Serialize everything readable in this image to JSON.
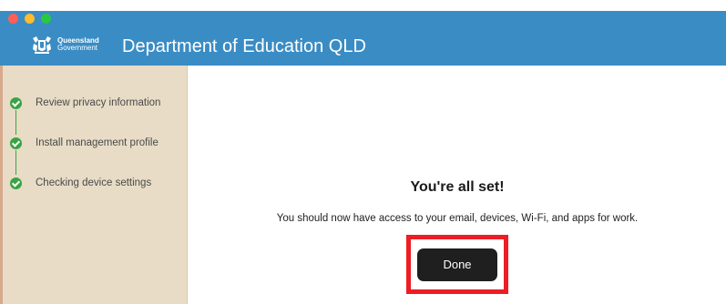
{
  "window": {
    "title": "Department of Education QLD"
  },
  "brand": {
    "line1": "Queensland",
    "line2": "Government"
  },
  "sidebar": {
    "steps": [
      {
        "label": "Review privacy information",
        "status": "complete"
      },
      {
        "label": "Install management profile",
        "status": "complete"
      },
      {
        "label": "Checking device settings",
        "status": "complete"
      }
    ]
  },
  "main": {
    "heading": "You're all set!",
    "message": "You should now have access to your email, devices, Wi-Fi, and apps for work.",
    "done_label": "Done"
  },
  "colors": {
    "titlebar": "#3a8cc4",
    "sidebar": "#e8dcc6",
    "step_complete": "#3aa346",
    "highlight": "#ee1c25",
    "button": "#1f1f1f"
  }
}
